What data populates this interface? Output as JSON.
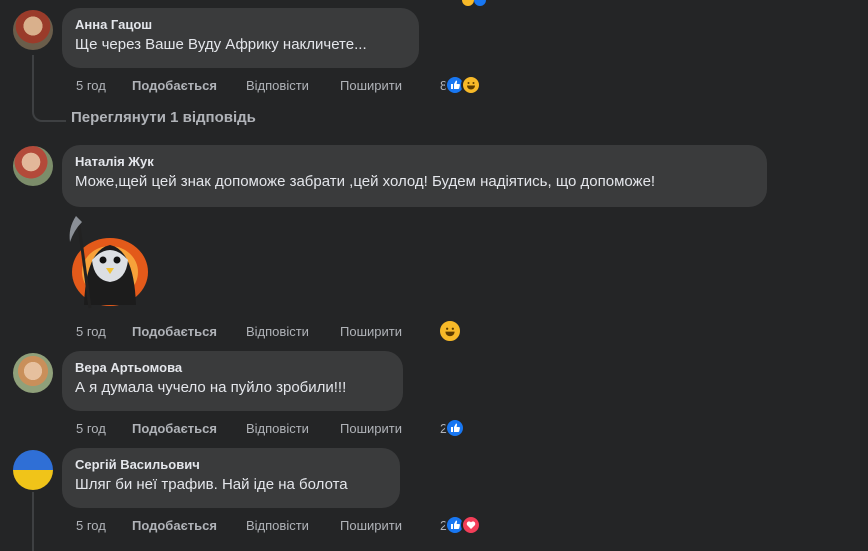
{
  "comments": [
    {
      "author": "Анна Гацош",
      "text": "Ще через Ваше Вуду Африку накличете...",
      "time": "5 год",
      "like_label": "Подобається",
      "reply_label": "Відповісти",
      "share_label": "Поширити",
      "reaction_count": "8",
      "reactions": [
        "like-icon",
        "haha-icon"
      ],
      "view_replies": "Переглянути 1 відповідь"
    },
    {
      "author": "Наталія Жук",
      "text": "Може,щей цей знак допоможе забрати ,цей холод! Будем надіятись, що допоможе!",
      "sticker": "grim-reaper-penguin-sticker",
      "time": "5 год",
      "like_label": "Подобається",
      "reply_label": "Відповісти",
      "share_label": "Поширити",
      "reactions": [
        "haha-icon"
      ]
    },
    {
      "author": "Вера Артьомова",
      "text": "А я думала чучело на пуйло зробили!!!",
      "time": "5 год",
      "like_label": "Подобається",
      "reply_label": "Відповісти",
      "share_label": "Поширити",
      "reaction_count": "2",
      "reactions": [
        "like-icon"
      ]
    },
    {
      "author": "Сергій Васильович",
      "text": "Шляг би неї трафив. Най іде на болота",
      "time": "5 год",
      "like_label": "Подобається",
      "reply_label": "Відповісти",
      "share_label": "Поширити",
      "reaction_count": "2",
      "reactions": [
        "like-icon",
        "love-icon"
      ]
    }
  ],
  "colors": {
    "background": "#242526",
    "bubble": "#3a3b3c",
    "text": "#e4e6eb",
    "secondary_text": "#b0b3b8",
    "like_blue": "#1877f2",
    "haha_yellow": "#f7b928",
    "love_red": "#f33e58"
  }
}
